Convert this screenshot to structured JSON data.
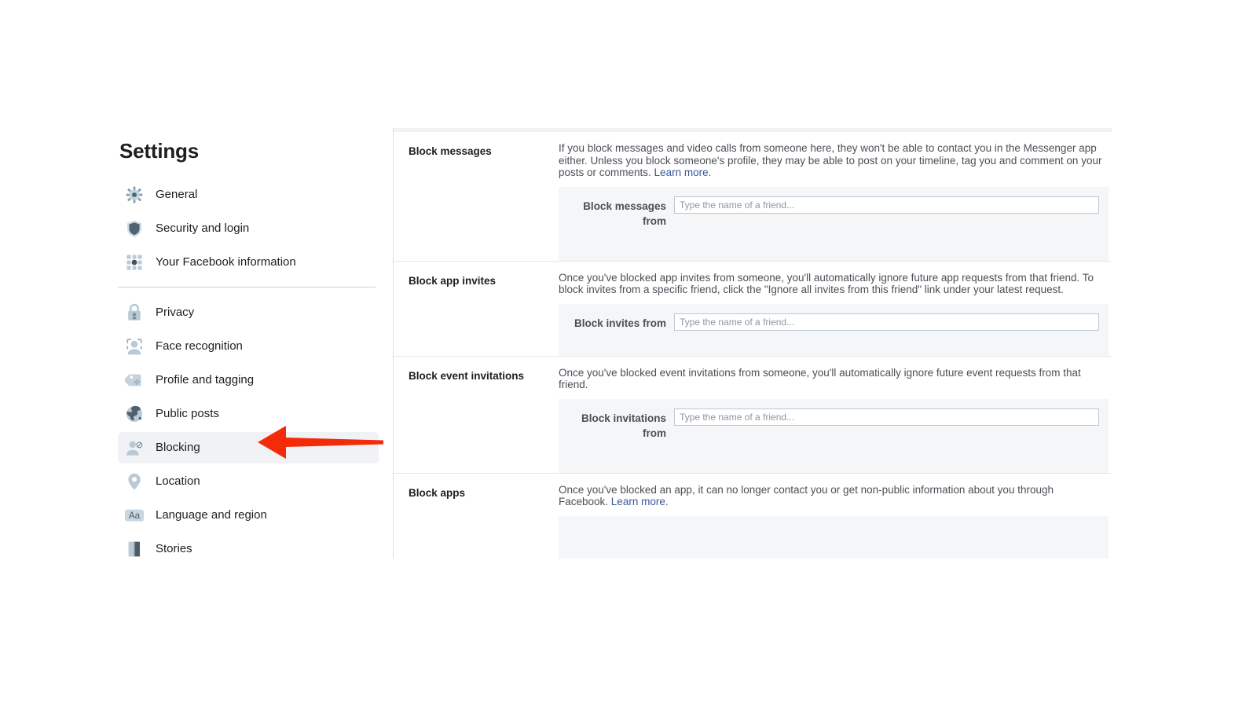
{
  "sidebar": {
    "title": "Settings",
    "group_one": [
      {
        "label": "General",
        "icon": "gear-icon"
      },
      {
        "label": "Security and login",
        "icon": "shield-icon"
      },
      {
        "label": "Your Facebook information",
        "icon": "grid-dots-icon"
      }
    ],
    "group_two": [
      {
        "label": "Privacy",
        "icon": "lock-icon",
        "active": false
      },
      {
        "label": "Face recognition",
        "icon": "face-scan-icon",
        "active": false
      },
      {
        "label": "Profile and tagging",
        "icon": "tag-icon",
        "active": false
      },
      {
        "label": "Public posts",
        "icon": "globe-icon",
        "active": false
      },
      {
        "label": "Blocking",
        "icon": "user-block-icon",
        "active": true
      },
      {
        "label": "Location",
        "icon": "location-pin-icon",
        "active": false
      },
      {
        "label": "Language and region",
        "icon": "aa-text-icon",
        "active": false
      },
      {
        "label": "Stories",
        "icon": "book-icon",
        "active": false
      }
    ]
  },
  "main": {
    "sections": [
      {
        "title": "Block messages",
        "description": "If you block messages and video calls from someone here, they won't be able to contact you in the Messenger app either. Unless you block someone's profile, they may be able to post on your timeline, tag you and comment on your posts or comments. ",
        "learn_more": "Learn more",
        "learn_more_suffix": ".",
        "form_label": "Block messages from",
        "input_placeholder": "Type the name of a friend...",
        "input_value": ""
      },
      {
        "title": "Block app invites",
        "description": "Once you've blocked app invites from someone, you'll automatically ignore future app requests from that friend. To block invites from a specific friend, click the \"Ignore all invites from this friend\" link under your latest request.",
        "learn_more": "",
        "learn_more_suffix": "",
        "form_label": "Block invites from",
        "input_placeholder": "Type the name of a friend...",
        "input_value": ""
      },
      {
        "title": "Block event invitations",
        "description": "Once you've blocked event invitations from someone, you'll automatically ignore future event requests from that friend.",
        "learn_more": "",
        "learn_more_suffix": "",
        "form_label": "Block invitations from",
        "input_placeholder": "Type the name of a friend...",
        "input_value": ""
      },
      {
        "title": "Block apps",
        "description": "Once you've blocked an app, it can no longer contact you or get non-public information about you through Facebook. ",
        "learn_more": "Learn more",
        "learn_more_suffix": ".",
        "form_label": "",
        "input_placeholder": "",
        "input_value": ""
      }
    ]
  },
  "annotation": {
    "type": "red-arrow-pointing-left",
    "color": "#f42b08",
    "points_at": "Blocking"
  },
  "colors": {
    "accent_link": "#385898",
    "active_row": "#f0f2f5",
    "form_bg": "#f5f6f7",
    "text_primary": "#1c1e21",
    "text_secondary": "#4b4f56",
    "annotation_red": "#f42b08"
  }
}
